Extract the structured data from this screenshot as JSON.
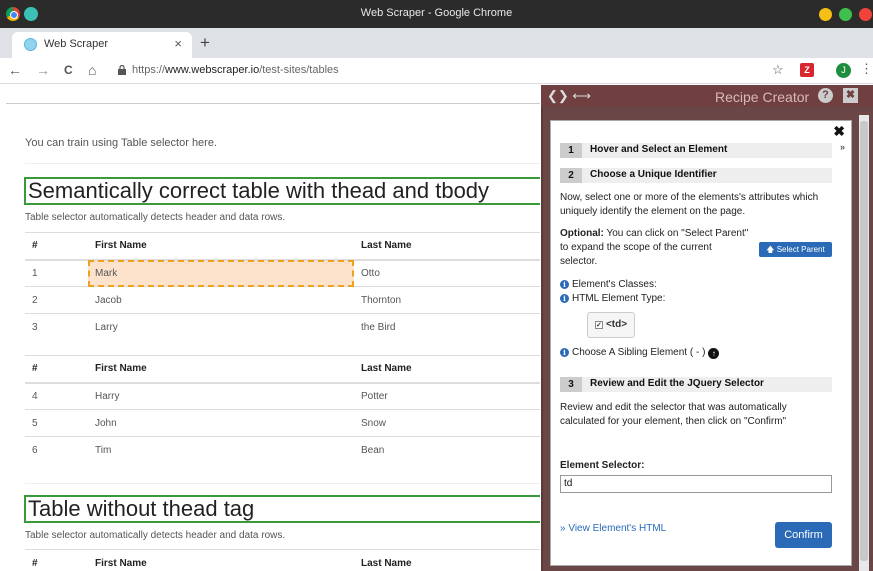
{
  "window": {
    "title": "Web Scraper - Google Chrome",
    "controls": [
      {
        "name": "minimize",
        "color": "#f5bf15"
      },
      {
        "name": "maximize",
        "color": "#3ec14a"
      },
      {
        "name": "close",
        "color": "#f0443a"
      }
    ]
  },
  "tab": {
    "title": "Web Scraper",
    "close": "×",
    "new_tab": "+"
  },
  "addressbar": {
    "back": "←",
    "forward": "→",
    "reload": "C",
    "home": "⌂",
    "url_prefix": "https://",
    "url_domain": "www.webscraper.io",
    "url_path": "/test-sites/tables",
    "star": "☆",
    "ext_label": "Z",
    "avatar_letter": "J",
    "menu": "⋮"
  },
  "page": {
    "intro": "You can train using Table selector here.",
    "section1": {
      "heading": "Semantically correct table with thead and tbody",
      "subtext": "Table selector automatically detects header and data rows.",
      "table1": {
        "headers": [
          "#",
          "First Name",
          "Last Name"
        ],
        "rows": [
          [
            "1",
            "Mark",
            "Otto"
          ],
          [
            "2",
            "Jacob",
            "Thornton"
          ],
          [
            "3",
            "Larry",
            "the Bird"
          ]
        ]
      },
      "table2": {
        "headers": [
          "#",
          "First Name",
          "Last Name"
        ],
        "rows": [
          [
            "4",
            "Harry",
            "Potter"
          ],
          [
            "5",
            "John",
            "Snow"
          ],
          [
            "6",
            "Tim",
            "Bean"
          ]
        ]
      }
    },
    "section2": {
      "heading": "Table without thead tag",
      "subtext": "Table selector automatically detects header and data rows.",
      "headers": [
        "#",
        "First Name",
        "Last Name"
      ]
    }
  },
  "recipe": {
    "nav": "❮❯ ⟷",
    "title": "Recipe Creator",
    "help": "?",
    "close": "✖",
    "dialog_close": "✖",
    "step1": {
      "num": "1",
      "label": "Hover and Select an Element",
      "chevron": "»"
    },
    "step2": {
      "num": "2",
      "label": "Choose a Unique Identifier",
      "desc": "Now, select one or more of the elements's attributes which uniquely identify the element on the page.",
      "optional_label": "Optional:",
      "optional_text": " You can click on \"Select Parent\" to expand the scope of the current selector.",
      "select_parent": "Select Parent",
      "classes_label": "Element's Classes:",
      "type_label": "HTML Element Type:",
      "type_value": "<td>",
      "sibling_label": "Choose A Sibling Element ( - )"
    },
    "step3": {
      "num": "3",
      "label": "Review and Edit the JQuery Selector",
      "desc": "Review and edit the selector that was automatically calculated for your element, then click on \"Confirm\"",
      "selector_label": "Element Selector:",
      "selector_value": "td",
      "view_html": "View Element's HTML",
      "confirm": "Confirm"
    }
  }
}
